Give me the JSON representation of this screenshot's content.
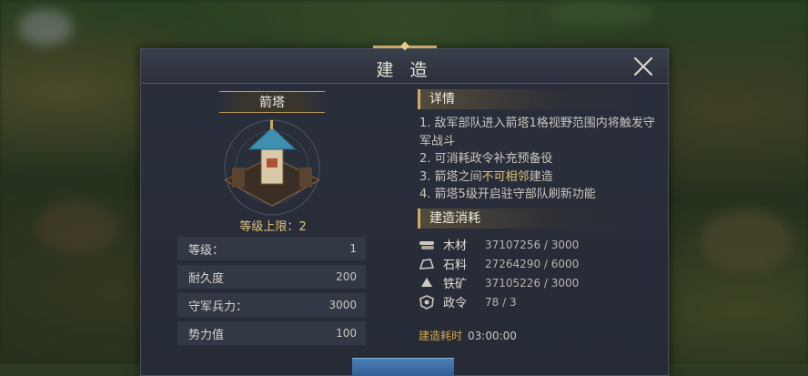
{
  "dialog": {
    "title": "建 造",
    "building_name": "箭塔",
    "level_limit": "等级上限：2",
    "stats": [
      {
        "label": "等级：",
        "value": "1"
      },
      {
        "label": "耐久度",
        "value": "200"
      },
      {
        "label": "守军兵力：",
        "value": "3000"
      },
      {
        "label": "势力值",
        "value": "100"
      }
    ],
    "details_header": "详情",
    "details": {
      "line1": "1. 敌军部队进入箭塔1格视野范围内将触发守军战斗",
      "line2": "2. 可消耗政令补充预备役",
      "line3_pre": "3. 箭塔之间",
      "line3_hl": "不可相邻",
      "line3_post": "建造",
      "line4": "4. 箭塔5级开启驻守部队刷新功能"
    },
    "cost_header": "建造消耗",
    "costs": [
      {
        "icon": "wood-icon",
        "name": "木材",
        "value": "37107256 / 3000"
      },
      {
        "icon": "stone-icon",
        "name": "石料",
        "value": "27264290 / 6000"
      },
      {
        "icon": "iron-icon",
        "name": "铁矿",
        "value": "37105226 / 3000"
      },
      {
        "icon": "decree-icon",
        "name": "政令",
        "value": "78 / 3"
      }
    ],
    "build_time_label": "建造耗时",
    "build_time_value": "03:00:00"
  },
  "colors": {
    "accent_gold": "#e6c37c",
    "panel": "#2a2f3c",
    "button_blue": "#3a6fa6"
  }
}
